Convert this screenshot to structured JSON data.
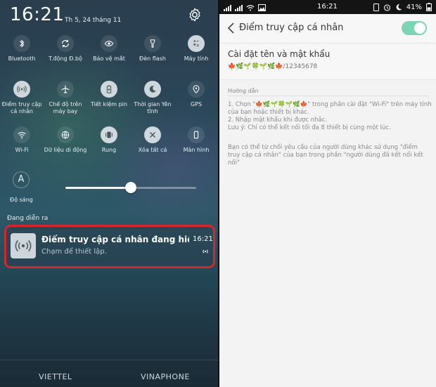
{
  "left_panel": {
    "clock": "16:21",
    "date": "Th 5, 24 tháng 11",
    "tiles": [
      {
        "label": "Bluetooth",
        "icon": "bluetooth-icon",
        "active": false
      },
      {
        "label": "T.động Đ.bộ",
        "icon": "sync-icon",
        "active": false
      },
      {
        "label": "Bảo vệ mắt",
        "icon": "eye-icon",
        "active": false
      },
      {
        "label": "Đèn flash",
        "icon": "flashlight-icon",
        "active": false
      },
      {
        "label": "Máy tính",
        "icon": "calculator-icon",
        "active": true
      },
      {
        "label": "Điểm truy cập cá nhân",
        "icon": "hotspot-icon",
        "active": true
      },
      {
        "label": "Chế độ trên máy bay",
        "icon": "airplane-icon",
        "active": false
      },
      {
        "label": "Tiết kiệm pin",
        "icon": "battery-saver-icon",
        "active": false
      },
      {
        "label": "Thời gian Yên tĩnh",
        "icon": "moon-icon",
        "active": false
      },
      {
        "label": "GPS",
        "icon": "location-icon",
        "active": false
      },
      {
        "label": "Wi-Fi",
        "icon": "wifi-icon",
        "active": false
      },
      {
        "label": "Dữ liệu di động",
        "icon": "mobile-data-icon",
        "active": false
      },
      {
        "label": "Rung",
        "icon": "vibrate-icon",
        "active": true
      },
      {
        "label": "Xóa tất cả",
        "icon": "close-all-icon",
        "active": true
      },
      {
        "label": "Màn hình",
        "icon": "screen-icon",
        "active": false
      }
    ],
    "brightness_label": "Độ sáng",
    "brightness_glyph": "A",
    "brightness_level": 0.5,
    "ongoing_label": "Đang diễn ra",
    "notification": {
      "title": "Điểm truy cập cá nhân đang hiện..",
      "subtitle": "Chạm để thiết lập.",
      "time": "16:21"
    },
    "carriers": [
      "VIETTEL",
      "VINAPHONE"
    ],
    "highlight_color": "#d8242b"
  },
  "right_panel": {
    "status_time": "16:21",
    "battery": "41%",
    "title": "Điểm truy cập cá nhân",
    "toggle_on": true,
    "toggle_color": "#7cd5b4",
    "section_title": "Cài đặt tên và mật khẩu",
    "section_value": "🍁🌿🌱🍀🌱🌿🍁/12345678",
    "guide_header": "Hướng dẫn",
    "guide_lines": [
      "1. Chọn \"🍁🌿🌱🍀🌱🌿🍁\" trong phần cài đặt \"Wi-Fi\" trên máy tính của bạn hoặc thiết bị khác.",
      "2. Nhập mật khẩu khi được nhắc.",
      "Lưu ý: Chỉ có thể kết nối tối đa 8 thiết bị cùng một lúc."
    ],
    "note": "Bạn có thể từ chối yêu cầu của người dùng khác sử dụng \"điểm truy cập cá nhân\" của bạn trong phần \"người dùng đã kết nối kết nối\""
  }
}
